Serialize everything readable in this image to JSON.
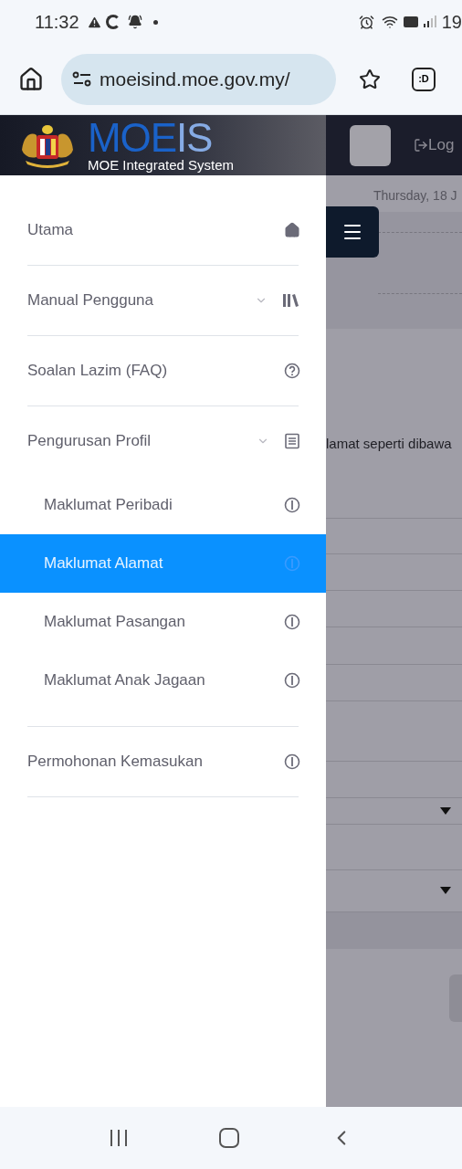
{
  "status_bar": {
    "time": "11:32",
    "battery": "19"
  },
  "browser": {
    "url": "moeisind.moe.gov.my/",
    "tab_button": ":D"
  },
  "header": {
    "title_main": "MOE",
    "title_accent": "IS",
    "subtitle": "MOE Integrated System",
    "logout": "Log"
  },
  "page": {
    "date": "Thursday, 18 J",
    "intro": "lamat seperti dibawa"
  },
  "drawer": {
    "items": [
      {
        "label": "Utama",
        "selected": false,
        "has_submenu": false
      },
      {
        "label": "Manual Pengguna",
        "selected": false,
        "has_submenu": true
      },
      {
        "label": "Soalan Lazim (FAQ)",
        "selected": false,
        "has_submenu": false
      },
      {
        "label": "Pengurusan Profil",
        "selected": false,
        "has_submenu": true,
        "children": [
          {
            "label": "Maklumat Peribadi",
            "selected": false
          },
          {
            "label": "Maklumat Alamat",
            "selected": true
          },
          {
            "label": "Maklumat Pasangan",
            "selected": false
          },
          {
            "label": "Maklumat Anak Jagaan",
            "selected": false
          }
        ]
      },
      {
        "label": "Permohonan Kemasukan",
        "selected": false,
        "has_submenu": false
      }
    ]
  }
}
